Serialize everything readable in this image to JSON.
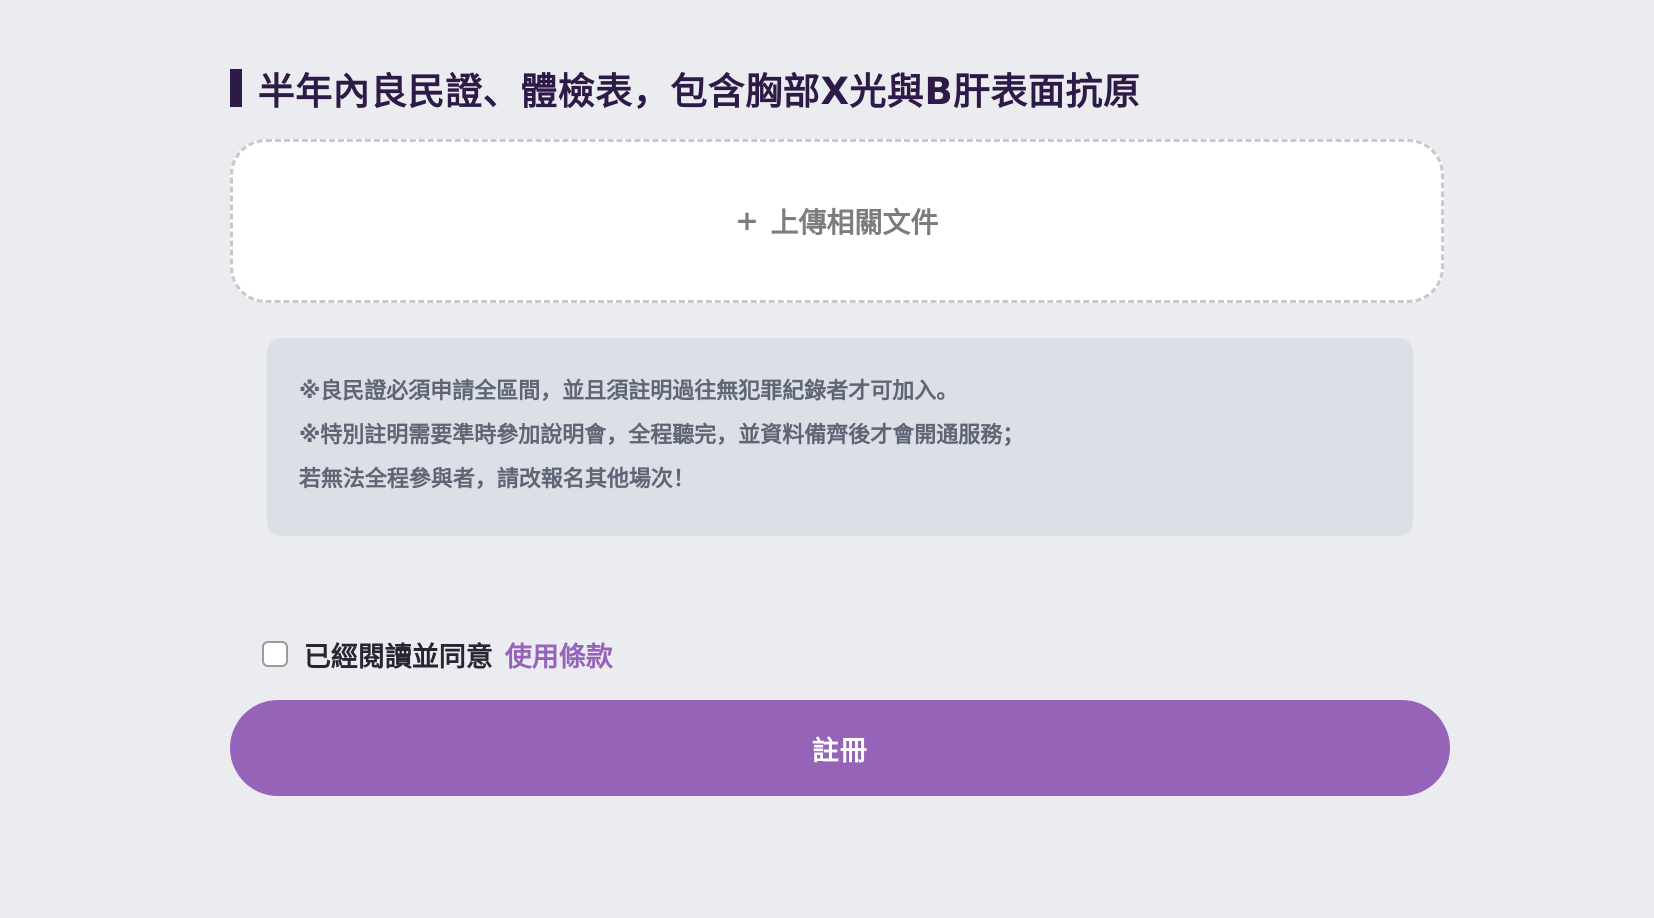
{
  "section": {
    "title": "半年內良民證、體檢表，包含胸部X光與B肝表面抗原"
  },
  "upload": {
    "plus": "+",
    "label": "上傳相關文件"
  },
  "notice": {
    "lines": [
      "※良民證必須申請全區間，並且須註明過往無犯罪紀錄者才可加入。",
      "※特別註明需要準時參加說明會，全程聽完，並資料備齊後才會開通服務；",
      "若無法全程參與者，請改報名其他場次！"
    ]
  },
  "agreement": {
    "text": "已經閱讀並同意",
    "link_label": "使用條款",
    "checked": false
  },
  "register": {
    "label": "註冊"
  },
  "colors": {
    "accent": "#9563b8",
    "title": "#2e1a47",
    "background": "#ebecf0",
    "notice_bg": "#dcdfe6"
  }
}
